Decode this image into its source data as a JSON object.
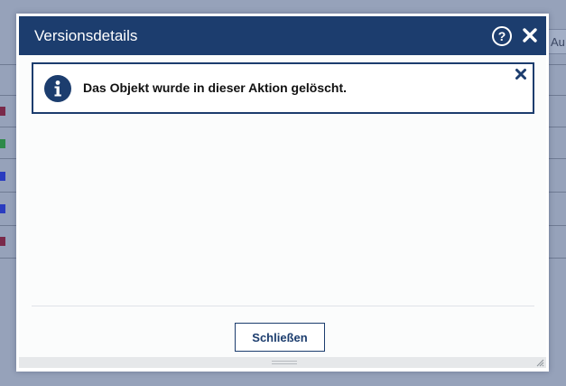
{
  "background": {
    "partial_button_text": "Au"
  },
  "dialog": {
    "title": "Versionsdetails",
    "help_icon": "help-circle-icon",
    "close_icon": "close-icon",
    "message": {
      "icon": "info-icon",
      "text": "Das Objekt wurde in dieser Aktion gelöscht.",
      "close_icon": "close-icon"
    },
    "close_button_label": "Schließen"
  },
  "colors": {
    "header": "#1c3d6e",
    "overlay": "#96a2ba",
    "row_markers": [
      "#7a2a4a",
      "#2e8a4a",
      "#2a3cc0",
      "#2a3cc0",
      "#7a2a4a"
    ]
  }
}
